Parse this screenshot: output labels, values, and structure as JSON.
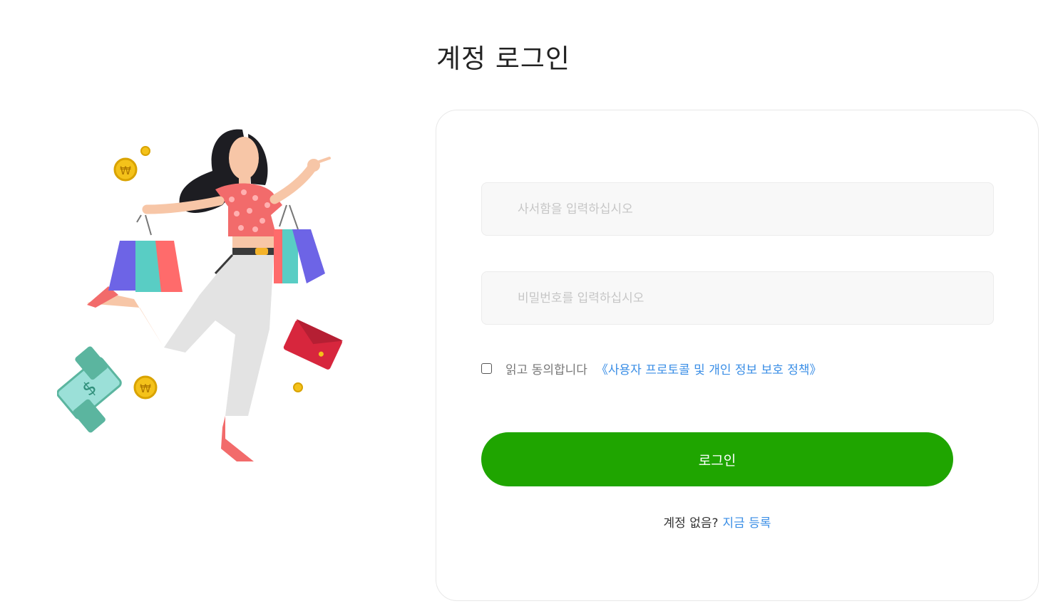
{
  "page": {
    "title": "계정 로그인"
  },
  "form": {
    "username_placeholder": "사서함을 입력하십시오",
    "password_placeholder": "비밀번호를 입력하십시오",
    "agree_checked": false,
    "agree_text": "읽고 동의합니다",
    "policy_link": "《사용자 프로토콜 및 개인 정보 보호 정책》",
    "login_button": "로그인",
    "no_account_text": "계정 없음?",
    "register_link": "지금 등록"
  },
  "colors": {
    "primary_button": "#1fa500",
    "link": "#3a8ee6",
    "input_bg": "#f8f8f8"
  },
  "illustration": {
    "icon": "shopping-woman-illustration"
  }
}
